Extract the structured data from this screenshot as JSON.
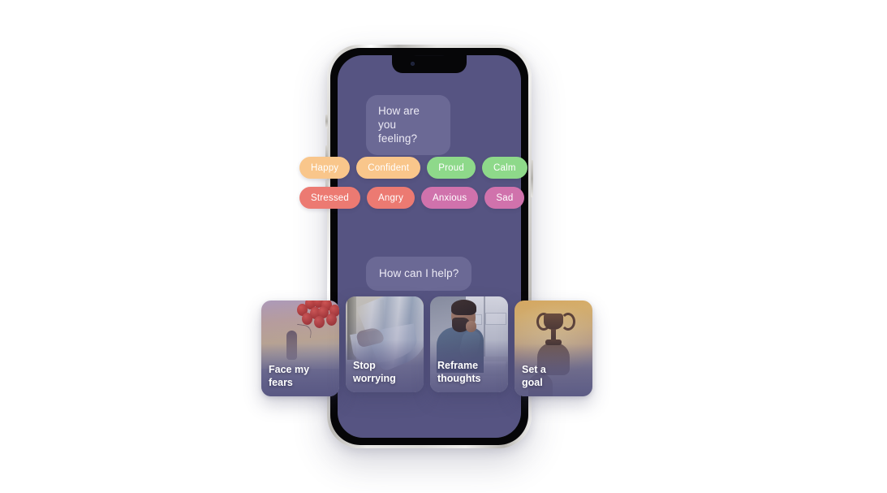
{
  "app": {
    "background_color": "#ffffff",
    "screen_background": "#565482",
    "bubble_background": "#6b6995",
    "bubble_text_color": "#eceaf5"
  },
  "phone": {
    "frame_finish": "silver",
    "notch": "notch",
    "camera": "front-camera",
    "speaker": "earpiece-speaker",
    "buttons": [
      "silent-switch",
      "volume-up",
      "volume-down",
      "power"
    ]
  },
  "chat": {
    "greeting": "How are you\nfeeling?",
    "prompt": "How can I help?"
  },
  "moods": {
    "rows": [
      [
        {
          "label": "Happy",
          "color": "#f9c68b"
        },
        {
          "label": "Confident",
          "color": "#f9c68b"
        },
        {
          "label": "Proud",
          "color": "#8ed98a"
        },
        {
          "label": "Calm",
          "color": "#8ed98a"
        }
      ],
      [
        {
          "label": "Stressed",
          "color": "#ec7a72"
        },
        {
          "label": "Angry",
          "color": "#ec7a72"
        },
        {
          "label": "Anxious",
          "color": "#d072ac"
        },
        {
          "label": "Sad",
          "color": "#d072ac"
        }
      ]
    ]
  },
  "actions": {
    "cards": [
      {
        "label": "Face my\nfears",
        "art": "balloons-photo"
      },
      {
        "label": "Stop\nworrying",
        "art": "hammock-photo"
      },
      {
        "label": "Reframe\nthoughts",
        "art": "man-thinking-photo"
      },
      {
        "label": "Set a\ngoal",
        "art": "trophy-photo"
      }
    ]
  }
}
